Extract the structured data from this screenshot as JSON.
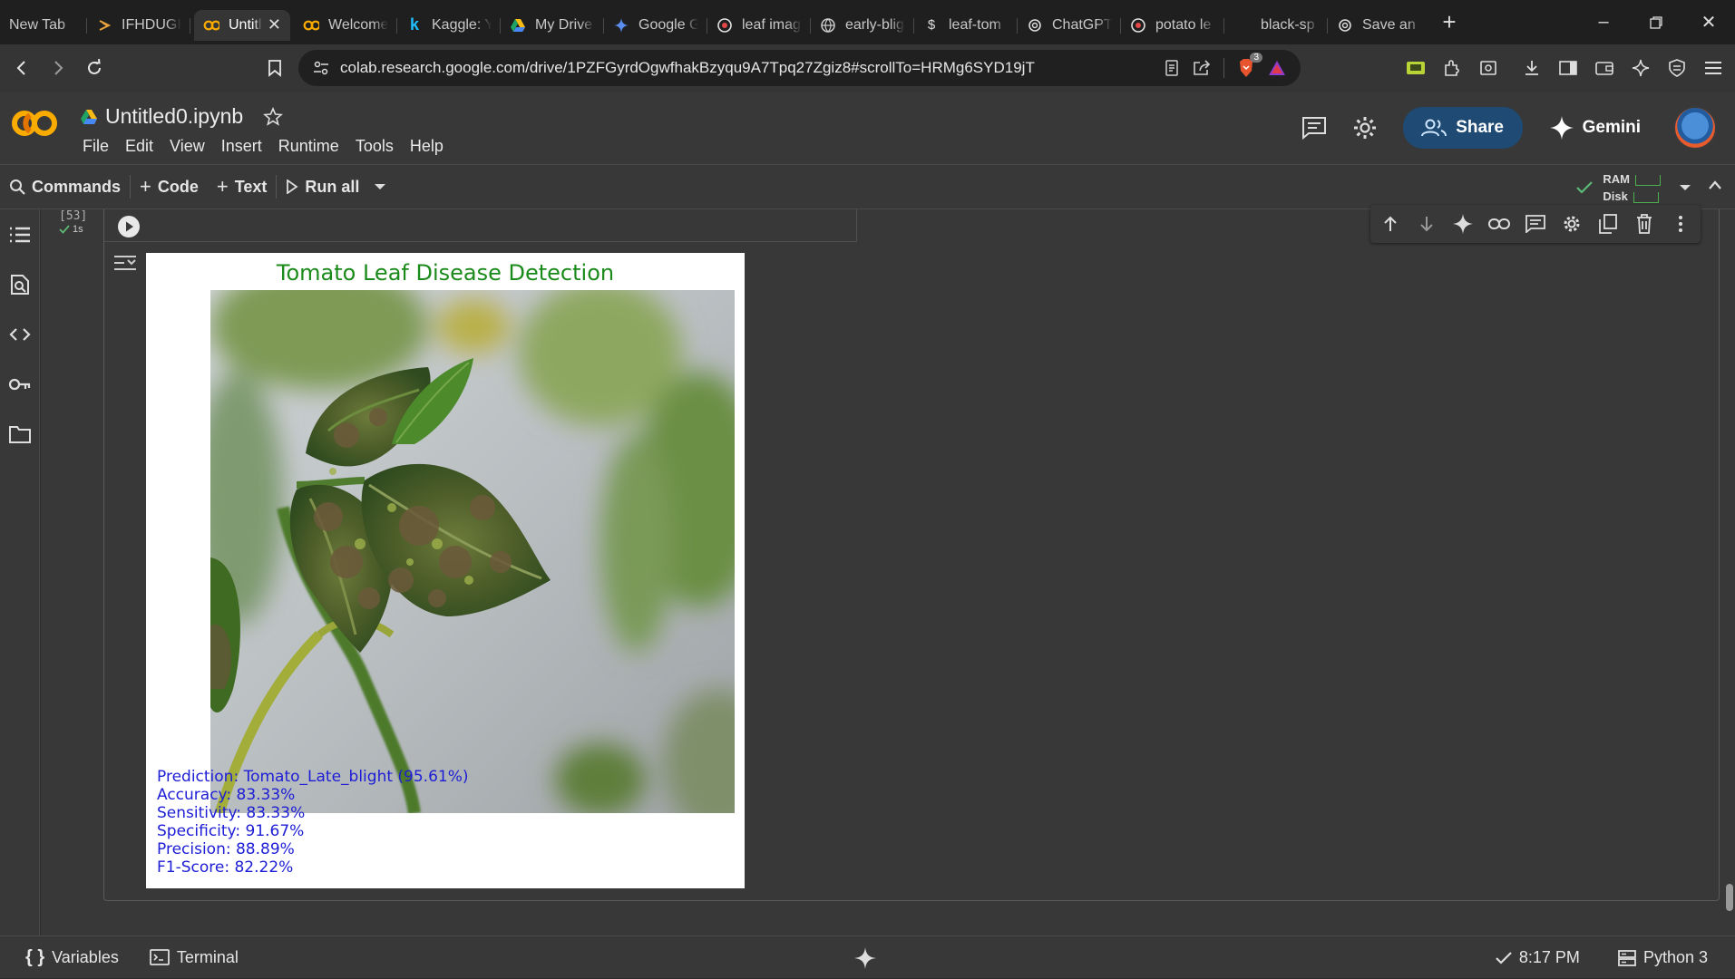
{
  "browser": {
    "tabs": [
      {
        "title": "New Tab",
        "icon": "none"
      },
      {
        "title": "IFHDUGI",
        "icon": "stream-icon"
      },
      {
        "title": "Untitl",
        "icon": "colab-icon",
        "active": true
      },
      {
        "title": "Welcome",
        "icon": "colab-icon"
      },
      {
        "title": "Kaggle: Y",
        "icon": "kaggle-icon"
      },
      {
        "title": "My Drive",
        "icon": "drive-icon"
      },
      {
        "title": "Google G",
        "icon": "gemini-icon"
      },
      {
        "title": "leaf imag",
        "icon": "brave-icon"
      },
      {
        "title": "early-blig",
        "icon": "globe-icon"
      },
      {
        "title": "leaf-tom",
        "icon": "dollar-icon"
      },
      {
        "title": "ChatGPT",
        "icon": "openai-icon"
      },
      {
        "title": "potato le",
        "icon": "brave-icon"
      },
      {
        "title": "black-sp",
        "icon": "none"
      },
      {
        "title": "Save an",
        "icon": "openai-icon"
      }
    ],
    "url": "colab.research.google.com/drive/1PZFGyrdOgwfhakBzyqu9A7Tpq27Zgiz8#scrollTo=HRMg6SYD19jT",
    "brave_badge": "3"
  },
  "colab": {
    "filename": "Untitled0.ipynb",
    "menu": [
      "File",
      "Edit",
      "View",
      "Insert",
      "Runtime",
      "Tools",
      "Help"
    ],
    "share_label": "Share",
    "gemini_label": "Gemini",
    "commands": {
      "commands_label": "Commands",
      "code_label": "Code",
      "text_label": "Text",
      "run_all_label": "Run all"
    },
    "resources": {
      "ram_label": "RAM",
      "disk_label": "Disk"
    }
  },
  "cell": {
    "number": "[53]",
    "exec_time": "1s"
  },
  "figure": {
    "title": "Tomato Leaf Disease Detection",
    "metrics": [
      "Prediction: Tomato_Late_blight (95.61%)",
      "Accuracy: 83.33%",
      "Sensitivity: 83.33%",
      "Specificity: 91.67%",
      "Precision: 88.89%",
      "F1-Score: 82.22%"
    ],
    "title_color": "#1a8a1a",
    "metrics_color": "#1d1dd6"
  },
  "statusbar": {
    "variables_label": "Variables",
    "terminal_label": "Terminal",
    "time": "8:17 PM",
    "kernel": "Python 3"
  }
}
